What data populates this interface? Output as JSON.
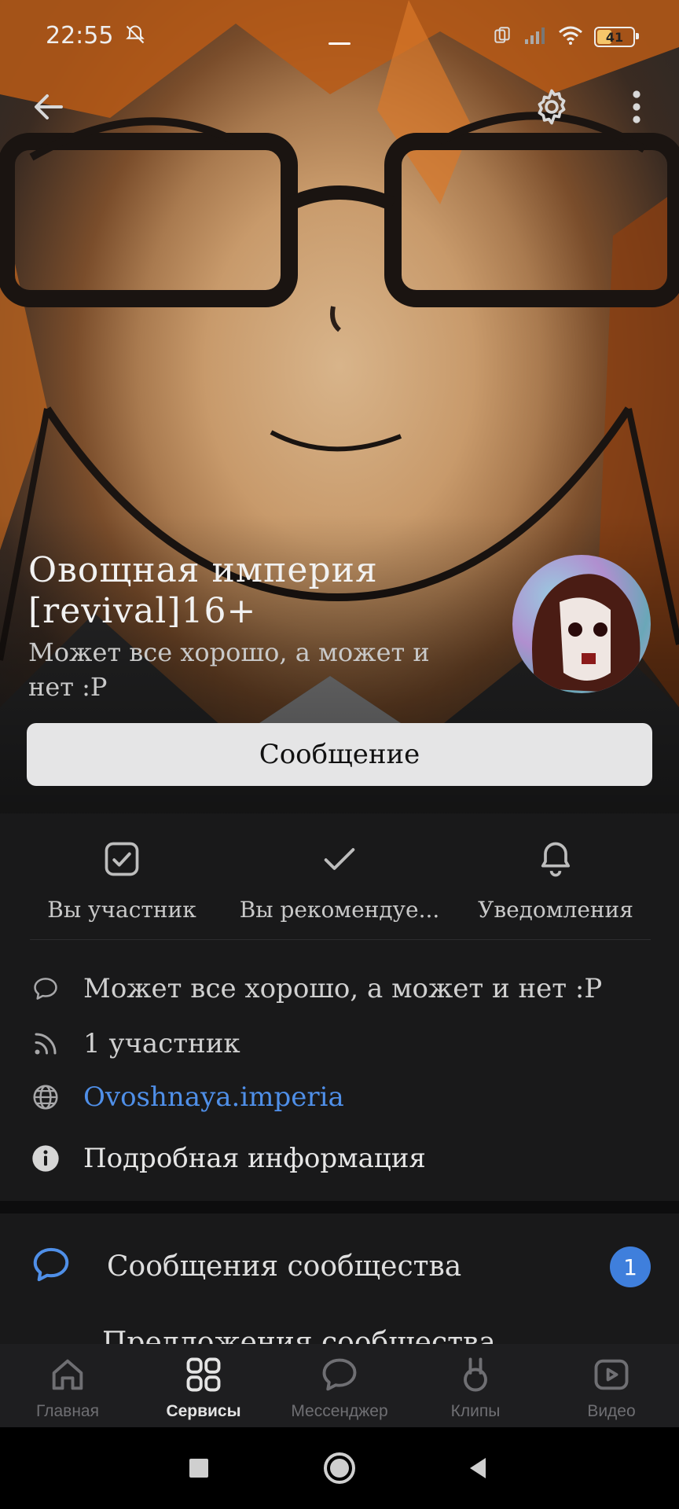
{
  "status_bar": {
    "time": "22:55",
    "battery": "41",
    "battery_level": 0.41
  },
  "group": {
    "title": "Овощная империя [revival]16+",
    "status": "Может все хорошо, а может и нет :P",
    "message_button": "Сообщение"
  },
  "actions": [
    {
      "label": "Вы участник",
      "icon": "checkbox-icon"
    },
    {
      "label": "Вы рекомендуе...",
      "icon": "check-icon"
    },
    {
      "label": "Уведомления",
      "icon": "bell-icon"
    }
  ],
  "info": {
    "description": "Может все хорошо, а может и нет :P",
    "members": "1 участник",
    "link": "Ovoshnaya.imperia",
    "details": "Подробная информация"
  },
  "community": {
    "messages_label": "Сообщения сообщества",
    "messages_badge": "1",
    "next_row_partial": "Предложения сообщества"
  },
  "tabbar": {
    "items": [
      {
        "label": "Главная",
        "icon": "home-icon"
      },
      {
        "label": "Сервисы",
        "icon": "services-icon",
        "active": true
      },
      {
        "label": "Мессенджер",
        "icon": "messenger-icon"
      },
      {
        "label": "Клипы",
        "icon": "clips-icon"
      },
      {
        "label": "Видео",
        "icon": "video-icon"
      }
    ]
  },
  "colors": {
    "accent": "#4f8fe8",
    "badge": "#3f7fdc",
    "background": "#19191a"
  }
}
